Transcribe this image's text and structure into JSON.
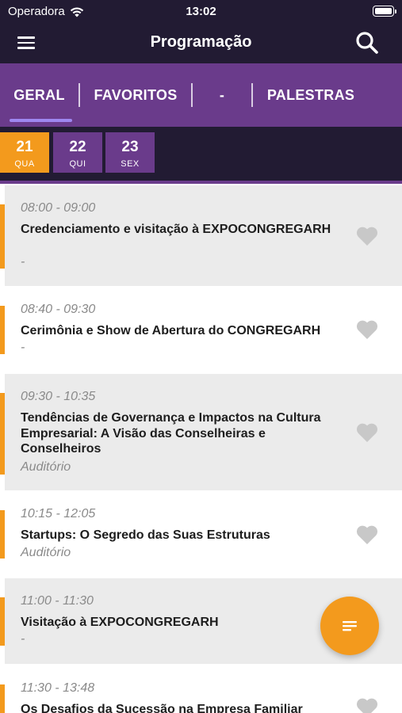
{
  "status_bar": {
    "carrier": "Operadora",
    "time": "13:02"
  },
  "nav": {
    "title": "Programação"
  },
  "tabs": [
    {
      "label": "GERAL",
      "active": true
    },
    {
      "label": "FAVORITOS",
      "active": false
    },
    {
      "label": "-",
      "active": false
    },
    {
      "label": "PALESTRAS",
      "active": false
    }
  ],
  "days": [
    {
      "num": "21",
      "weekday": "QUA",
      "active": true
    },
    {
      "num": "22",
      "weekday": "QUI",
      "active": false
    },
    {
      "num": "23",
      "weekday": "SEX",
      "active": false
    }
  ],
  "sessions": [
    {
      "time": "08:00 - 09:00",
      "title": "Credenciamento e visitação à EXPOCONGREGARH",
      "location": "-"
    },
    {
      "time": "08:40 - 09:30",
      "title": "Cerimônia e Show de Abertura do CONGREGARH",
      "location": "-"
    },
    {
      "time": "09:30 - 10:35",
      "title": "Tendências de Governança e Impactos na Cultura Empresarial: A Visão das Conselheiras e Conselheiros",
      "location": "Auditório"
    },
    {
      "time": "10:15 - 12:05",
      "title": "Startups: O Segredo das Suas Estruturas",
      "location": "Auditório"
    },
    {
      "time": "11:00 - 11:30",
      "title": "Visitação à EXPOCONGREGARH",
      "location": "-"
    },
    {
      "time": "11:30 - 13:48",
      "title": "Os Desafios da Sucessão na Empresa Familiar",
      "location": ""
    }
  ],
  "colors": {
    "accent": "#f39a1d",
    "purple": "#6a3b8b",
    "dark": "#221b33",
    "heart": "#c8c8c8"
  }
}
